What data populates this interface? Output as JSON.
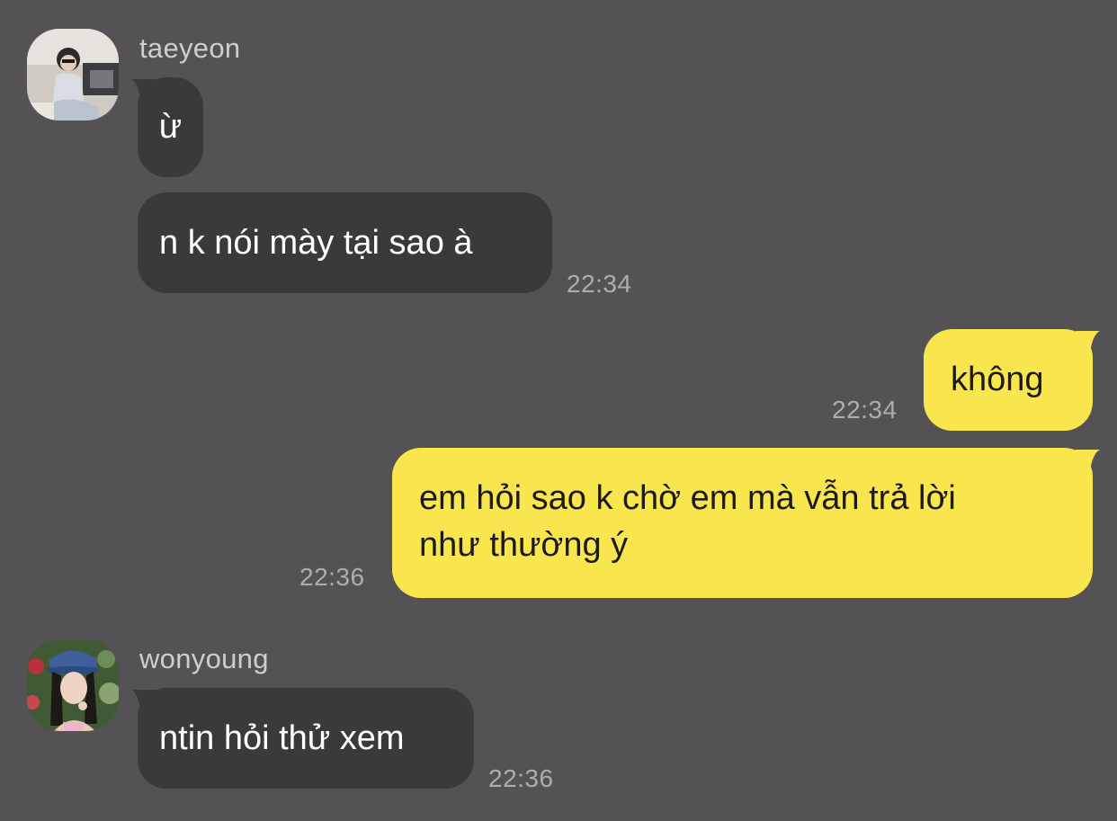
{
  "colors": {
    "background": "#545254",
    "incoming_bubble": "#3a393b",
    "outgoing_bubble": "#f9e64f"
  },
  "messages": [
    {
      "sender": "taeyeon",
      "avatar": "taeyeon-avatar",
      "bubbles": [
        "ừ",
        "n k nói mày tại sao à"
      ],
      "time": "22:34"
    },
    {
      "outgoing": true,
      "bubbles": [
        "không"
      ],
      "time": "22:34"
    },
    {
      "outgoing": true,
      "lines": [
        "em hỏi sao k chờ em mà vẫn trả lời",
        "như thường ý"
      ],
      "time": "22:36"
    },
    {
      "sender": "wonyoung",
      "avatar": "wonyoung-avatar",
      "bubbles": [
        "ntin hỏi thử xem"
      ],
      "time": "22:36"
    }
  ]
}
